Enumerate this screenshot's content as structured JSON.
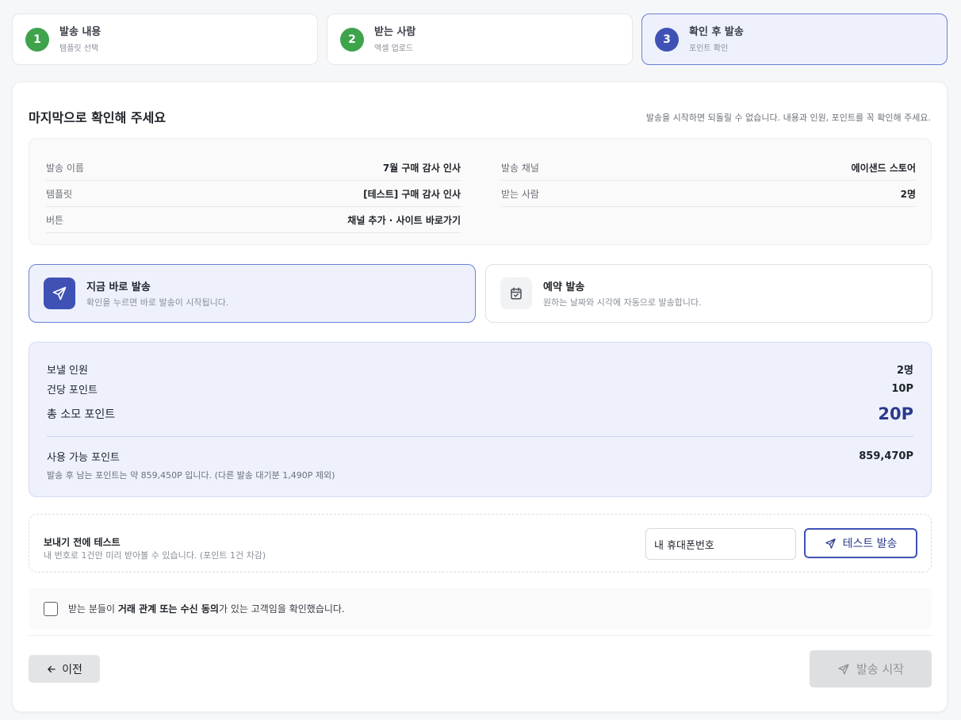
{
  "steps": [
    {
      "num": "1",
      "title": "발송 내용",
      "sub": "템플릿 선택"
    },
    {
      "num": "2",
      "title": "받는 사람",
      "sub": "엑셀 업로드"
    },
    {
      "num": "3",
      "title": "확인 후 발송",
      "sub": "포인트 확인"
    }
  ],
  "card": {
    "title": "마지막으로 확인해 주세요",
    "subtitle": "발송을 시작하면 되돌릴 수 없습니다. 내용과 인원, 포인트를 꼭 확인해 주세요."
  },
  "summary": {
    "left": [
      {
        "key": "발송 이름",
        "value": "7월 구매 감사 인사"
      },
      {
        "key": "템플릿",
        "value": "[테스트] 구매 감사 인사"
      },
      {
        "key": "버튼",
        "value": "채널 추가 · 사이트 바로가기"
      }
    ],
    "right": [
      {
        "key": "발송 채널",
        "value": "에이샌드 스토어"
      },
      {
        "key": "받는 사람",
        "value": "2명"
      }
    ]
  },
  "send_options": {
    "now": {
      "title": "지금 바로 발송",
      "desc": "확인을 누르면 바로 발송이 시작됩니다."
    },
    "later": {
      "title": "예약 발송",
      "desc": "원하는 날짜와 시각에 자동으로 발송합니다."
    }
  },
  "points": {
    "recipients_label": "보낼 인원",
    "recipients_value": "2명",
    "per_label": "건당 포인트",
    "per_value": "10P",
    "total_label": "총 소모 포인트",
    "total_value": "20P",
    "available_label": "사용 가능 포인트",
    "available_value": "859,470P",
    "note": "발송 후 남는 포인트는 약 859,450P 입니다. (다른 발송 대기분 1,490P 제외)"
  },
  "test": {
    "title": "보내기 전에 테스트",
    "desc": "내 번호로 1건만 미리 받아볼 수 있습니다. (포인트 1건 차감)",
    "phone_value": "내 휴대폰번호",
    "button_label": "테스트 발송"
  },
  "consent": {
    "prefix": "받는 분들이 ",
    "bold": "거래 관계 또는 수신 동의",
    "suffix": "가 있는 고객임을 확인했습니다."
  },
  "footer": {
    "prev_label": "이전",
    "start_label": "발송 시작"
  },
  "colors": {
    "accent": "#3f51b5",
    "step_done": "#3ea34b",
    "points_bg": "#eef1fc",
    "disabled": "#dedfe1"
  }
}
